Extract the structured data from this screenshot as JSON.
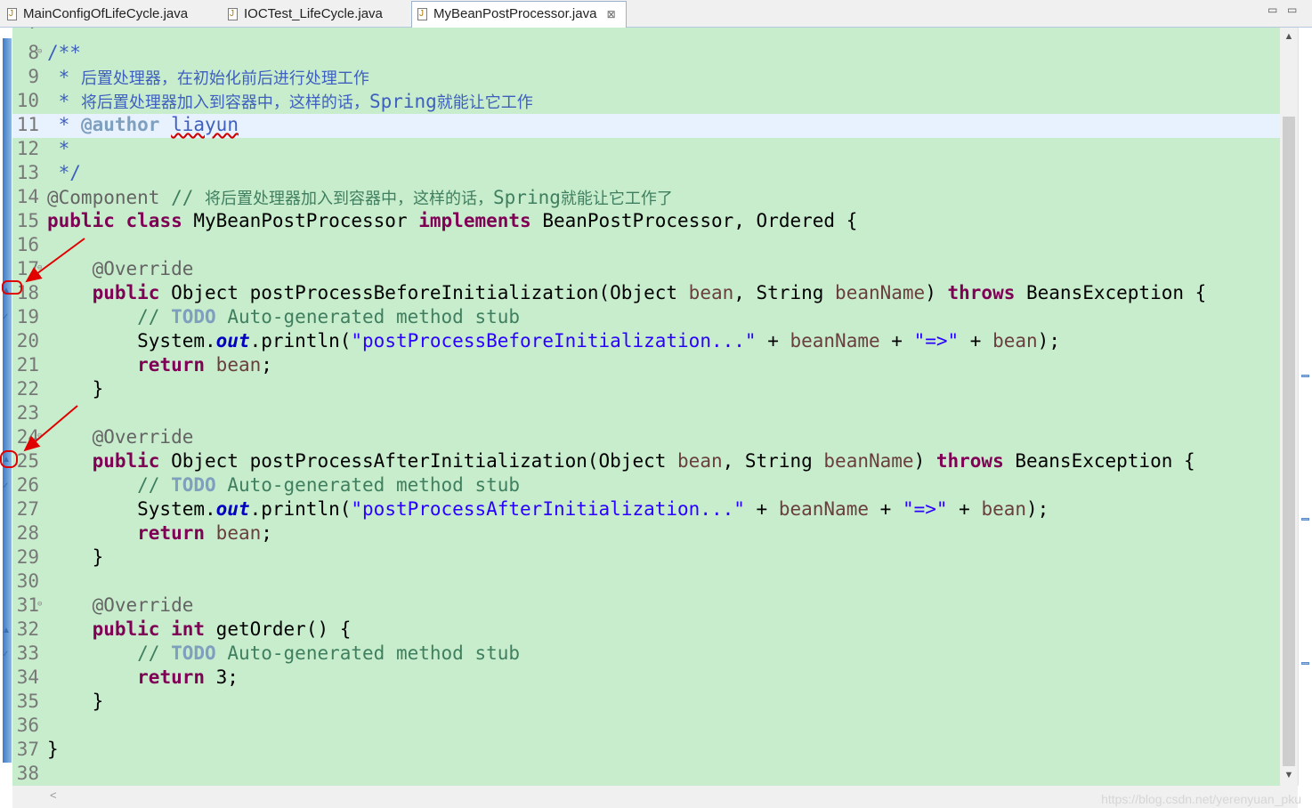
{
  "tabs": [
    {
      "label": "MainConfigOfLifeCycle.java",
      "active": false
    },
    {
      "label": "IOCTest_LifeCycle.java",
      "active": false
    },
    {
      "label": "MyBeanPostProcessor.java",
      "active": true,
      "close": "⊠"
    }
  ],
  "window_controls": {
    "minimize": "▭",
    "maximize": "▭"
  },
  "editor": {
    "first_partial_line": "7",
    "highlighted_line": "11",
    "lines": [
      {
        "n": "8",
        "fold": "⊖",
        "segs": [
          [
            "jd",
            "/**"
          ]
        ]
      },
      {
        "n": "9",
        "segs": [
          [
            "jd",
            " * "
          ],
          [
            "jdcn",
            "后置处理器，在初始化前后进行处理工作"
          ]
        ]
      },
      {
        "n": "10",
        "segs": [
          [
            "jd",
            " * "
          ],
          [
            "jdcn",
            "将后置处理器加入到容器中，这样的话，"
          ],
          [
            "jd",
            "Spring"
          ],
          [
            "jdcn",
            "就能让它工作"
          ]
        ]
      },
      {
        "n": "11",
        "segs": [
          [
            "jd",
            " * "
          ],
          [
            "jdt",
            "@author"
          ],
          [
            "jd",
            " "
          ],
          [
            "jdsq",
            "liayun"
          ]
        ]
      },
      {
        "n": "12",
        "segs": [
          [
            "jd",
            " *"
          ]
        ]
      },
      {
        "n": "13",
        "segs": [
          [
            "jd",
            " */"
          ]
        ]
      },
      {
        "n": "14",
        "segs": [
          [
            "ann",
            "@Component"
          ],
          [
            "cm",
            " // "
          ],
          [
            "cmcn",
            "将后置处理器加入到容器中，这样的话，"
          ],
          [
            "cm",
            "Spring"
          ],
          [
            "cmcn",
            "就能让它工作了"
          ]
        ]
      },
      {
        "n": "15",
        "segs": [
          [
            "kw",
            "public"
          ],
          [
            "",
            " "
          ],
          [
            "kw",
            "class"
          ],
          [
            "",
            " MyBeanPostProcessor "
          ],
          [
            "kw",
            "implements"
          ],
          [
            "",
            " BeanPostProcessor, Ordered {"
          ]
        ]
      },
      {
        "n": "16",
        "segs": []
      },
      {
        "n": "17",
        "fold": "⊖",
        "segs": [
          [
            "",
            "    "
          ],
          [
            "ann",
            "@Override"
          ]
        ]
      },
      {
        "n": "18",
        "segs": [
          [
            "",
            "    "
          ],
          [
            "kw",
            "public"
          ],
          [
            "",
            " Object postProcessBeforeInitialization(Object "
          ],
          [
            "var",
            "bean"
          ],
          [
            "",
            ", String "
          ],
          [
            "var",
            "beanName"
          ],
          [
            "",
            ") "
          ],
          [
            "kw",
            "throws"
          ],
          [
            "",
            " BeansException {"
          ]
        ]
      },
      {
        "n": "19",
        "segs": [
          [
            "",
            "        "
          ],
          [
            "cm",
            "// "
          ],
          [
            "todo",
            "TODO"
          ],
          [
            "cm",
            " Auto-generated method stub"
          ]
        ]
      },
      {
        "n": "20",
        "segs": [
          [
            "",
            "        System."
          ],
          [
            "fld",
            "out"
          ],
          [
            "",
            ".println("
          ],
          [
            "str",
            "\"postProcessBeforeInitialization...\""
          ],
          [
            "",
            " + "
          ],
          [
            "var",
            "beanName"
          ],
          [
            "",
            " + "
          ],
          [
            "str",
            "\"=>\""
          ],
          [
            "",
            " + "
          ],
          [
            "var",
            "bean"
          ],
          [
            "",
            ");"
          ]
        ]
      },
      {
        "n": "21",
        "segs": [
          [
            "",
            "        "
          ],
          [
            "kw",
            "return"
          ],
          [
            "",
            " "
          ],
          [
            "var",
            "bean"
          ],
          [
            "",
            ";"
          ]
        ]
      },
      {
        "n": "22",
        "segs": [
          [
            "",
            "    }"
          ]
        ]
      },
      {
        "n": "23",
        "segs": []
      },
      {
        "n": "24",
        "fold": "⊖",
        "segs": [
          [
            "",
            "    "
          ],
          [
            "ann",
            "@Override"
          ]
        ]
      },
      {
        "n": "25",
        "segs": [
          [
            "",
            "    "
          ],
          [
            "kw",
            "public"
          ],
          [
            "",
            " Object postProcessAfterInitialization(Object "
          ],
          [
            "var",
            "bean"
          ],
          [
            "",
            ", String "
          ],
          [
            "var",
            "beanName"
          ],
          [
            "",
            ") "
          ],
          [
            "kw",
            "throws"
          ],
          [
            "",
            " BeansException {"
          ]
        ]
      },
      {
        "n": "26",
        "segs": [
          [
            "",
            "        "
          ],
          [
            "cm",
            "// "
          ],
          [
            "todo",
            "TODO"
          ],
          [
            "cm",
            " Auto-generated method stub"
          ]
        ]
      },
      {
        "n": "27",
        "segs": [
          [
            "",
            "        System."
          ],
          [
            "fld",
            "out"
          ],
          [
            "",
            ".println("
          ],
          [
            "str",
            "\"postProcessAfterInitialization...\""
          ],
          [
            "",
            " + "
          ],
          [
            "var",
            "beanName"
          ],
          [
            "",
            " + "
          ],
          [
            "str",
            "\"=>\""
          ],
          [
            "",
            " + "
          ],
          [
            "var",
            "bean"
          ],
          [
            "",
            ");"
          ]
        ]
      },
      {
        "n": "28",
        "segs": [
          [
            "",
            "        "
          ],
          [
            "kw",
            "return"
          ],
          [
            "",
            " "
          ],
          [
            "var",
            "bean"
          ],
          [
            "",
            ";"
          ]
        ]
      },
      {
        "n": "29",
        "segs": [
          [
            "",
            "    }"
          ]
        ]
      },
      {
        "n": "30",
        "segs": []
      },
      {
        "n": "31",
        "fold": "⊖",
        "segs": [
          [
            "",
            "    "
          ],
          [
            "ann",
            "@Override"
          ]
        ]
      },
      {
        "n": "32",
        "segs": [
          [
            "",
            "    "
          ],
          [
            "kw",
            "public"
          ],
          [
            "",
            " "
          ],
          [
            "kw",
            "int"
          ],
          [
            "",
            " getOrder() {"
          ]
        ]
      },
      {
        "n": "33",
        "segs": [
          [
            "",
            "        "
          ],
          [
            "cm",
            "// "
          ],
          [
            "todo",
            "TODO"
          ],
          [
            "cm",
            " Auto-generated method stub"
          ]
        ]
      },
      {
        "n": "34",
        "segs": [
          [
            "",
            "        "
          ],
          [
            "kw",
            "return"
          ],
          [
            "",
            " 3;"
          ]
        ]
      },
      {
        "n": "35",
        "segs": [
          [
            "",
            "    }"
          ]
        ]
      },
      {
        "n": "36",
        "segs": []
      },
      {
        "n": "37",
        "segs": [
          [
            "",
            "}"
          ]
        ]
      },
      {
        "n": "38",
        "segs": []
      }
    ]
  },
  "gutter_markers": [
    {
      "line": "18",
      "icon": "override-triangle-icon",
      "highlighted": true
    },
    {
      "line": "19",
      "icon": "task-icon"
    },
    {
      "line": "25",
      "icon": "override-triangle-icon",
      "highlighted": true
    },
    {
      "line": "26",
      "icon": "task-icon"
    },
    {
      "line": "32",
      "icon": "override-triangle-icon"
    },
    {
      "line": "33",
      "icon": "task-icon"
    }
  ],
  "scrollbar": {
    "up": "▲",
    "down": "▼",
    "left": "<"
  },
  "watermark": "https://blog.csdn.net/yerenyuan_pku",
  "colors": {
    "editor_bg": "#c7edcc",
    "keyword": "#7f0055",
    "string": "#2a00ff",
    "comment": "#3f7f5f",
    "javadoc": "#3f5fbf",
    "annotation_arrows": "#e00000"
  }
}
